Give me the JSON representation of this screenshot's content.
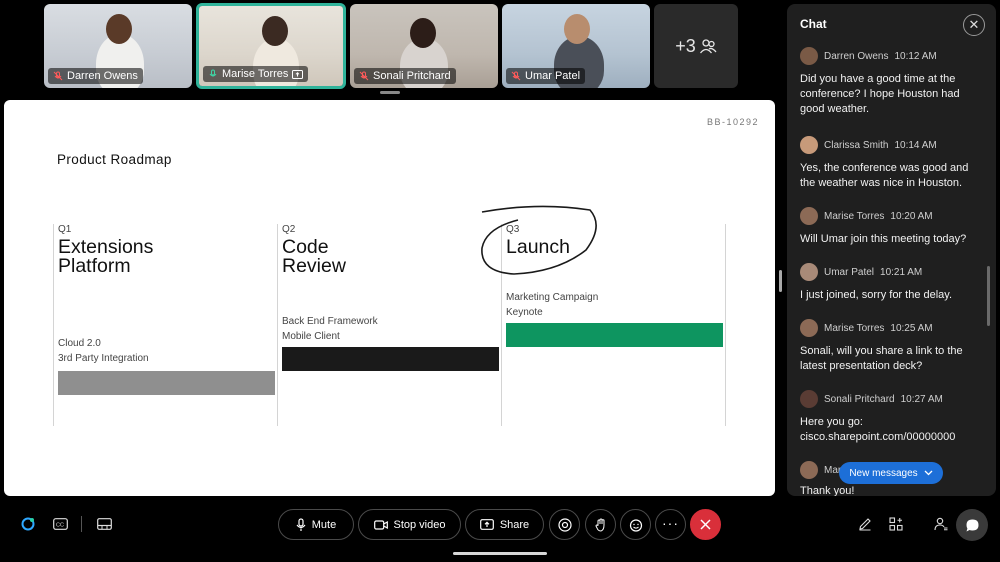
{
  "participants": [
    {
      "name": "Darren Owens",
      "muted": true
    },
    {
      "name": "Marise Torres",
      "muted": false,
      "sharing": true,
      "active": true
    },
    {
      "name": "Sonali Pritchard",
      "muted": true
    },
    {
      "name": "Umar Patel",
      "muted": true
    }
  ],
  "more_participants": "+3",
  "slide": {
    "code": "BB-10292",
    "title": "Product Roadmap",
    "columns": [
      {
        "quarter": "Q1",
        "heading_line1": "Extensions",
        "heading_line2": "Platform",
        "item1": "Cloud 2.0",
        "item2": "3rd Party Integration",
        "bar_color": "#8f8f8f"
      },
      {
        "quarter": "Q2",
        "heading_line1": "Code",
        "heading_line2": "Review",
        "item1": "Back End Framework",
        "item2": "Mobile Client",
        "bar_color": "#1a1a1a"
      },
      {
        "quarter": "Q3",
        "heading_line1": "Launch",
        "heading_line2": "",
        "item1": "Marketing Campaign",
        "item2": "Keynote",
        "bar_color": "#0e9560"
      }
    ]
  },
  "chat": {
    "title": "Chat",
    "messages": [
      {
        "sender": "Darren Owens",
        "time": "10:12 AM",
        "text": "Did you have a good time at the conference? I hope Houston had good weather."
      },
      {
        "sender": "Clarissa Smith",
        "time": "10:14 AM",
        "text": "Yes, the conference was good and the weather was nice in Houston."
      },
      {
        "sender": "Marise Torres",
        "time": "10:20 AM",
        "text": "Will Umar join this meeting today?"
      },
      {
        "sender": "Umar Patel",
        "time": "10:21 AM",
        "text": "I just joined, sorry for the delay."
      },
      {
        "sender": "Marise Torres",
        "time": "10:25 AM",
        "text": "Sonali, will you share a link to the latest presentation deck?"
      },
      {
        "sender": "Sonali Pritchard",
        "time": "10:27 AM",
        "text": "Here you go: cisco.sharepoint.com/00000000"
      },
      {
        "sender": "Mar",
        "time": "",
        "text": "Thank you!"
      }
    ],
    "new_messages_label": "New messages"
  },
  "controls": {
    "mute_label": "Mute",
    "stop_video_label": "Stop video",
    "share_label": "Share"
  },
  "colors": {
    "active_border": "#2fb39a",
    "end_call": "#d92f3a",
    "new_messages": "#1d6fd8",
    "launch_bar": "#0e9560"
  }
}
